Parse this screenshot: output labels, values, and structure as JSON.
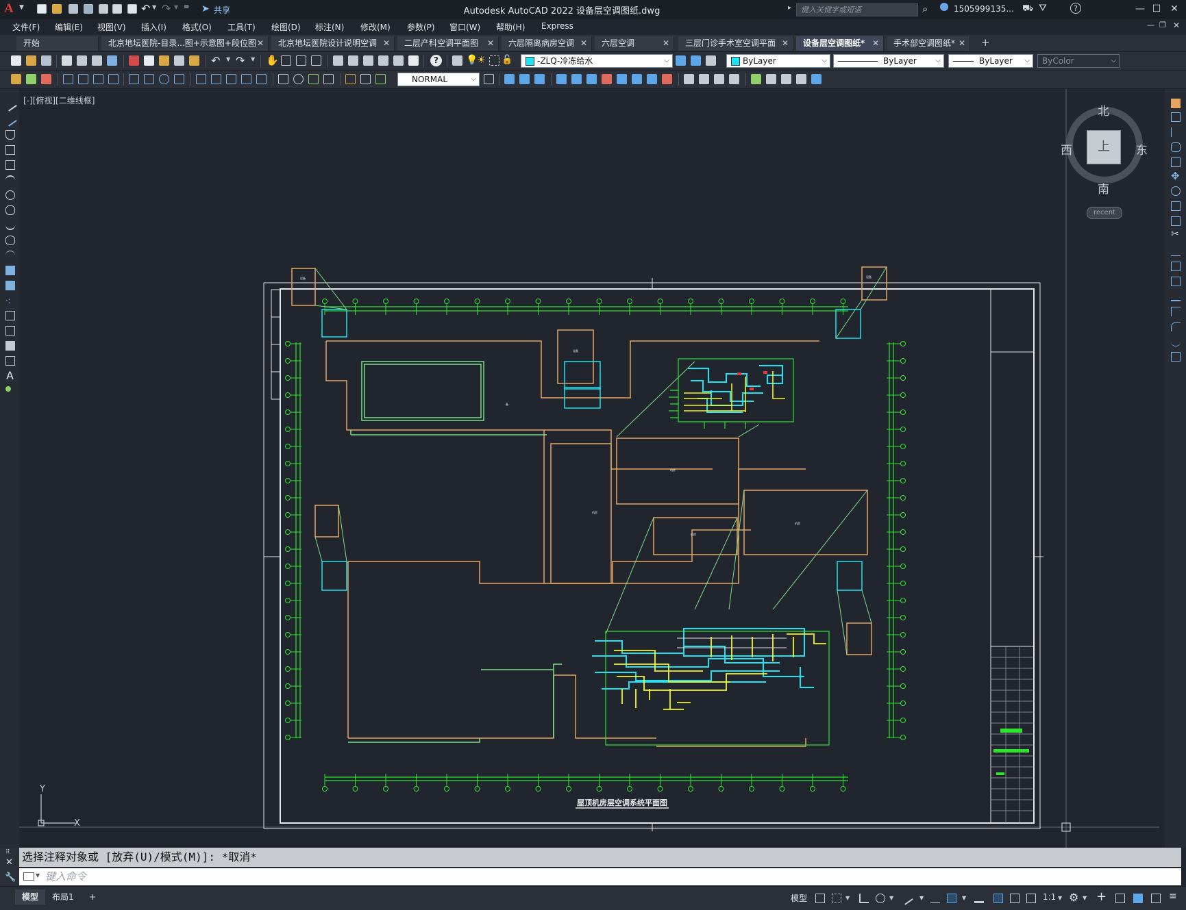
{
  "app": {
    "title": "Autodesk AutoCAD 2022    设备层空调图纸.dwg",
    "logo": "A",
    "share_label": "共享",
    "search_placeholder": "键入关键字或短语",
    "user": "1505999135...",
    "help": "?"
  },
  "menu": [
    "文件(F)",
    "编辑(E)",
    "视图(V)",
    "插入(I)",
    "格式(O)",
    "工具(T)",
    "绘图(D)",
    "标注(N)",
    "修改(M)",
    "参数(P)",
    "窗口(W)",
    "帮助(H)",
    "Express"
  ],
  "tabs": [
    {
      "label": "开始",
      "closable": false
    },
    {
      "label": "北京地坛医院-目录...图+示意图+段位图",
      "closable": true
    },
    {
      "label": "北京地坛医院设计说明空调",
      "closable": true
    },
    {
      "label": "二层产科空调平面图",
      "closable": true
    },
    {
      "label": "六层隔离病房空调",
      "closable": true
    },
    {
      "label": "六层空调",
      "closable": true
    },
    {
      "label": "三层门诊手术室空调平面",
      "closable": true
    },
    {
      "label": "设备层空调图纸*",
      "closable": true,
      "active": true
    },
    {
      "label": "手术部空调图纸*",
      "closable": true
    }
  ],
  "toolbar": {
    "layer": "-ZLQ-冷冻给水",
    "color": "ByLayer",
    "linetype": "ByLayer",
    "lineweight": "ByLayer",
    "plotstyle": "ByColor",
    "dimstyle": "NORMAL"
  },
  "viewport": {
    "label": "[-][俯视][二维线框]",
    "compass": {
      "north": "北",
      "south": "南",
      "east": "东",
      "west": "西",
      "top": "上"
    },
    "recent": "recent",
    "ucs_y": "Y",
    "ucs_x": "X"
  },
  "drawing": {
    "title": "屋顶机房层空调系统平面图"
  },
  "command": {
    "history": "选择注释对象或 [放弃(U)/模式(M)]: *取消*",
    "placeholder": "键入命令"
  },
  "status": {
    "model_tab": "模型",
    "layout_tab": "布局1",
    "add": "+",
    "model_label": "模型",
    "scale": "1:1"
  },
  "colors": {
    "bg": "#21252d",
    "orange": "#e8a561",
    "green": "#2ee52e",
    "cyan": "#1ee3f2",
    "yellow": "#f5f51a",
    "white": "#ffffff"
  }
}
